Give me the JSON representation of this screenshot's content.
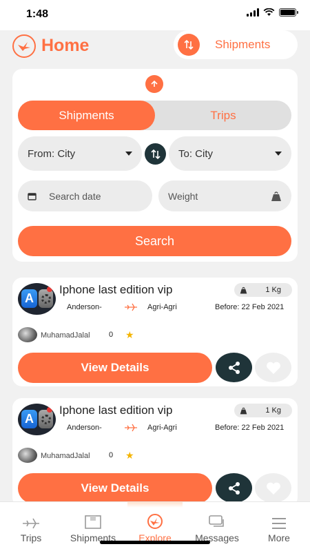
{
  "status_bar": {
    "time": "1:48"
  },
  "header": {
    "title": "Home",
    "shipments_button_label": "Shipments"
  },
  "search_panel": {
    "tabs": {
      "active": "Shipments",
      "inactive": "Trips"
    },
    "from_placeholder": "From: City",
    "to_placeholder": "To: City",
    "date_placeholder": "Search date",
    "weight_placeholder": "Weight",
    "search_label": "Search"
  },
  "shipments": [
    {
      "title": "Iphone last edition vip",
      "weight": "1 Kg",
      "from": "Anderson-",
      "to": "Agri-Agri",
      "before": "Before: 22 Feb 2021",
      "user": "MuhamadJalal",
      "rating": "0",
      "view_label": "View Details"
    },
    {
      "title": "Iphone last edition vip",
      "weight": "1 Kg",
      "from": "Anderson-",
      "to": "Agri-Agri",
      "before": "Before: 22 Feb 2021",
      "user": "MuhamadJalal",
      "rating": "0",
      "view_label": "View Details"
    }
  ],
  "tab_bar": {
    "trips": "Trips",
    "shipments": "Shipments",
    "explore": "Explore",
    "messages": "Messages",
    "more": "More"
  },
  "colors": {
    "accent": "#ff7043",
    "dark": "#1f3439",
    "star": "#f4b400"
  }
}
